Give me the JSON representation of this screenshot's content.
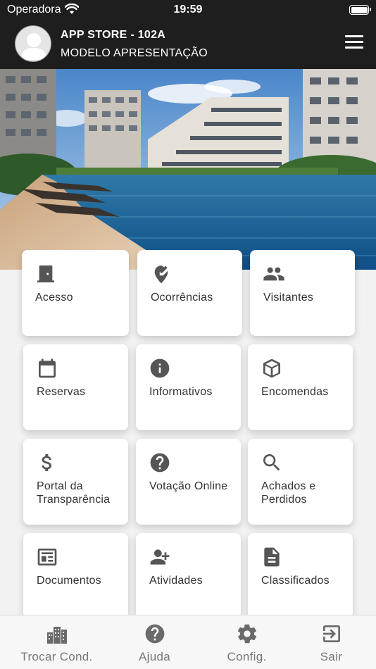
{
  "status_bar": {
    "carrier": "Operadora",
    "time": "19:59"
  },
  "header": {
    "title": "APP STORE - 102A",
    "subtitle": "MODELO APRESENTAÇÃO"
  },
  "tiles": [
    {
      "label": "Acesso",
      "icon": "door-icon"
    },
    {
      "label": "Ocorrências",
      "icon": "edit-pin-icon"
    },
    {
      "label": "Visitantes",
      "icon": "people-icon"
    },
    {
      "label": "Reservas",
      "icon": "calendar-icon"
    },
    {
      "label": "Informativos",
      "icon": "info-icon"
    },
    {
      "label": "Encomendas",
      "icon": "box-icon"
    },
    {
      "label": "Portal da Transparência",
      "icon": "dollar-icon"
    },
    {
      "label": "Votação Online",
      "icon": "help-icon"
    },
    {
      "label": "Achados e Perdidos",
      "icon": "search-icon"
    },
    {
      "label": "Documentos",
      "icon": "newspaper-icon"
    },
    {
      "label": "Atividades",
      "icon": "add-person-icon"
    },
    {
      "label": "Classificados",
      "icon": "document-icon"
    }
  ],
  "bottom_nav": [
    {
      "label": "Trocar Cond.",
      "icon": "buildings-icon"
    },
    {
      "label": "Ajuda",
      "icon": "help-icon"
    },
    {
      "label": "Config.",
      "icon": "gear-icon"
    },
    {
      "label": "Sair",
      "icon": "exit-icon"
    }
  ],
  "colors": {
    "header_bg": "#1e1e1e",
    "icon": "#555555",
    "nav_icon": "#6a6a6a"
  }
}
